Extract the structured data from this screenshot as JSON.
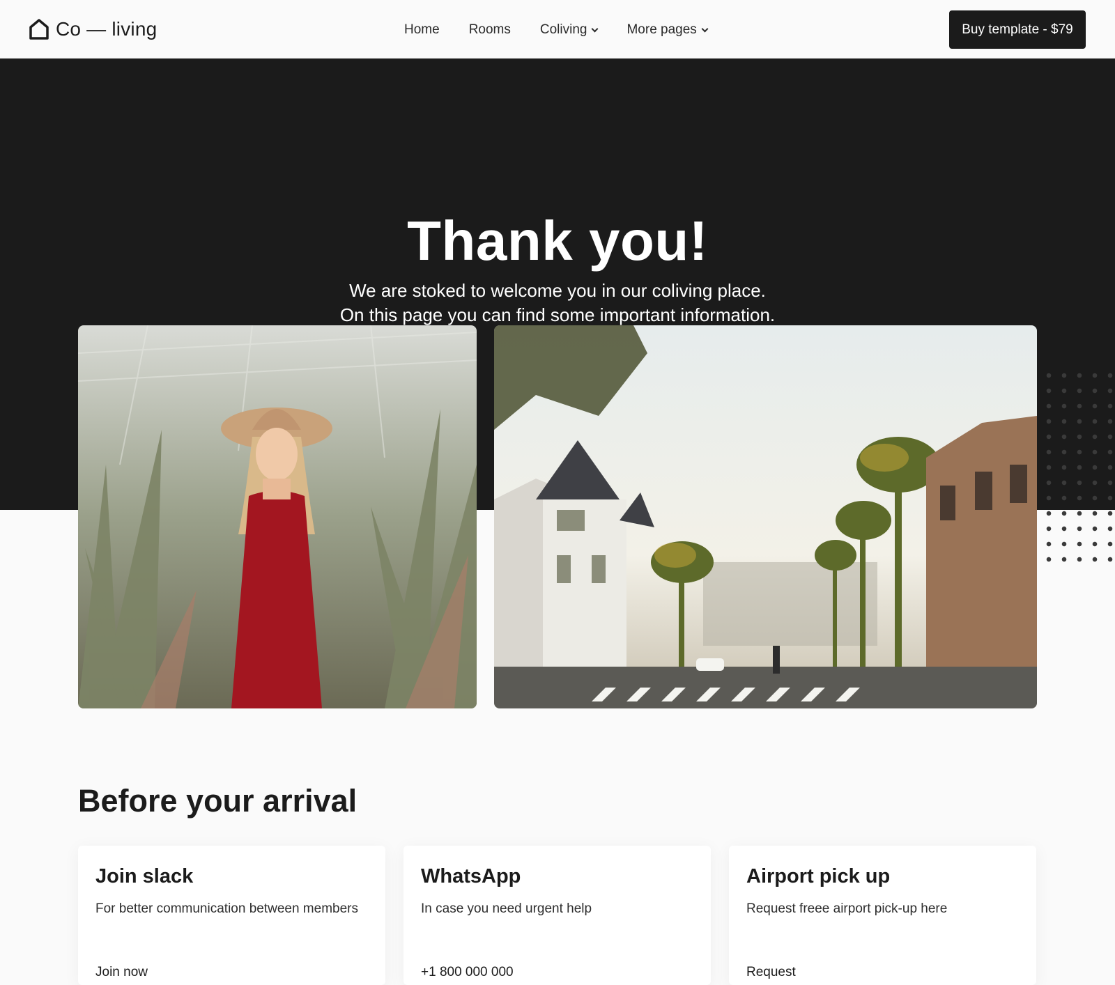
{
  "nav": {
    "logo_text": "Co — living",
    "links": [
      {
        "label": "Home",
        "dropdown": false
      },
      {
        "label": "Rooms",
        "dropdown": false
      },
      {
        "label": "Coliving",
        "dropdown": true
      },
      {
        "label": "More pages",
        "dropdown": true
      }
    ],
    "cta_label": "Buy template - $79"
  },
  "hero": {
    "title": "Thank you!",
    "subtitle_line1": "We are stoked to welcome you in our coliving place.",
    "subtitle_line2": "On this page you can find some important information."
  },
  "arrival": {
    "title": "Before your arrival",
    "cards": [
      {
        "title": "Join slack",
        "text": "For better communication between members",
        "link": "Join now"
      },
      {
        "title": "WhatsApp",
        "text": "In case you need urgent help",
        "link": "+1 800 000 000"
      },
      {
        "title": "Airport pick up",
        "text": "Request freee airport pick-up here",
        "link": "Request"
      }
    ]
  },
  "colors": {
    "dark": "#1b1b1b",
    "background": "#fafafa",
    "card": "#ffffff"
  }
}
